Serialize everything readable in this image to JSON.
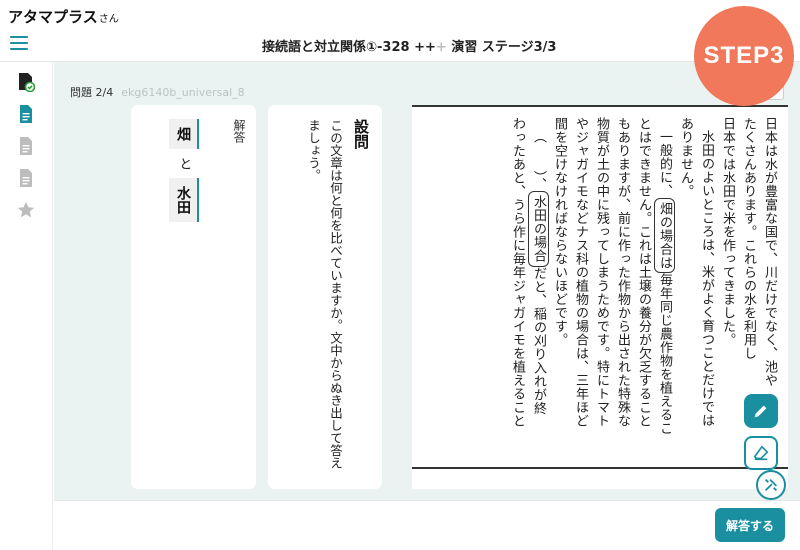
{
  "app": {
    "name": "アタマプラス",
    "name_suffix": "さん"
  },
  "header": {
    "title": "接続語と対立関係①-328",
    "plus_active": "++",
    "plus_dim": "+",
    "mode": "演習 ステージ3/3",
    "step_badge": "STEP3"
  },
  "question": {
    "progress": "問題 2/4",
    "id": "ekg6140b_universal_8"
  },
  "answer": {
    "label": "解答",
    "first": "畑",
    "connector": "と",
    "second": "水田"
  },
  "prompt": {
    "heading": "設問",
    "text": "この文章は何と何を比べていますか。文中からぬき出して答えましょう。"
  },
  "passage": {
    "lines": [
      "日本は水が豊富な国で、川だけでなく、池や",
      "たくさんあります。これらの水を利用し",
      "日本では水田で米を作ってきました。",
      "水田のよいところは、米がよく育つことだけでは",
      "ありません。",
      "一般的に、",
      "とはできません。これは土壌の養分が欠乏すること",
      "もありますが、前に作った作物から出された特殊な",
      "物質が土の中に残ってしまうためです。特にトマト",
      "やジャガイモなどナス科の植物の場合は、三年ほど",
      "間を空けなければならないほどです。",
      "（　　）、",
      "わったあと、うら作に毎年ジャガイモを植えること"
    ],
    "highlight_field": "畑の場合は",
    "line6_rest": "毎年同じ農作物を植えるこ",
    "highlight_paddy": "水田の場合",
    "line12_rest": "だと、稲の刈り入れが終"
  },
  "tools": {
    "pen": "pencil-icon",
    "eraser": "eraser-icon",
    "toolbox": "tools-icon"
  },
  "footer": {
    "submit_label": "解答する"
  },
  "colors": {
    "accent": "#1a8fa0",
    "badge": "#f1785b",
    "background": "#eaf3f2"
  }
}
